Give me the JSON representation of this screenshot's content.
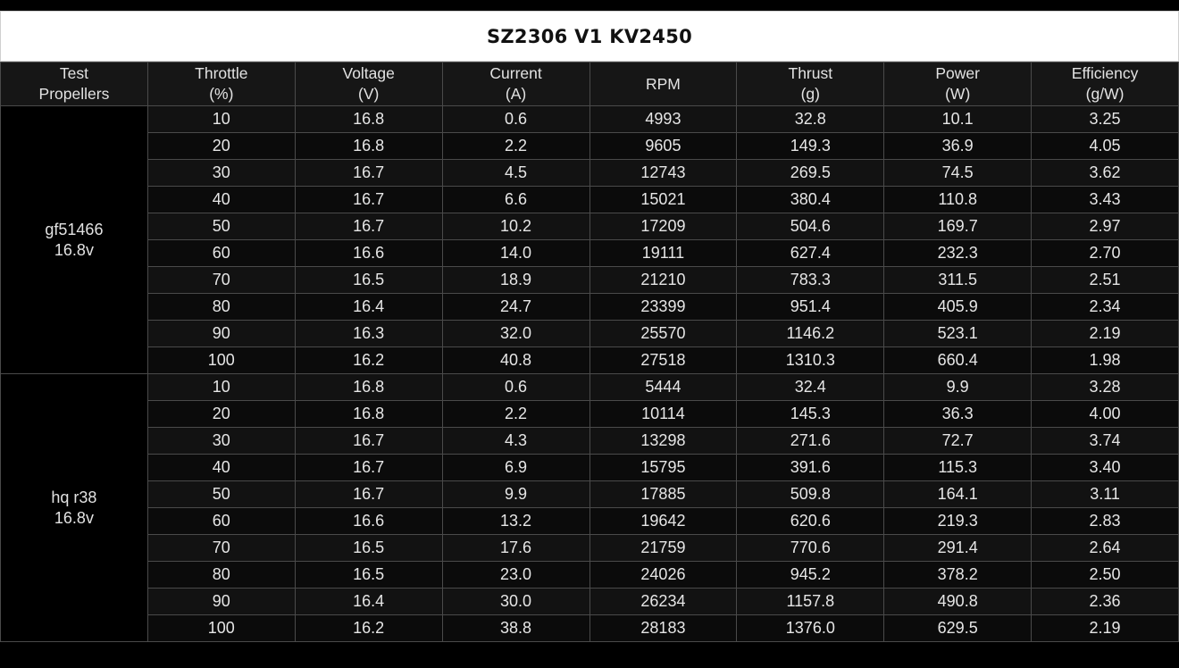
{
  "title": "SZ2306 V1 KV2450",
  "headers": [
    [
      "Test",
      "Propellers"
    ],
    [
      "Throttle",
      "(%)"
    ],
    [
      "Voltage",
      "(V)"
    ],
    [
      "Current",
      "(A)"
    ],
    [
      "RPM"
    ],
    [
      "Thrust",
      "(g)"
    ],
    [
      "Power",
      "(W)"
    ],
    [
      "Efficiency",
      "(g/W)"
    ]
  ],
  "groups": [
    {
      "propeller": [
        "gf51466",
        "16.8v"
      ],
      "rows": [
        [
          "10",
          "16.8",
          "0.6",
          "4993",
          "32.8",
          "10.1",
          "3.25"
        ],
        [
          "20",
          "16.8",
          "2.2",
          "9605",
          "149.3",
          "36.9",
          "4.05"
        ],
        [
          "30",
          "16.7",
          "4.5",
          "12743",
          "269.5",
          "74.5",
          "3.62"
        ],
        [
          "40",
          "16.7",
          "6.6",
          "15021",
          "380.4",
          "110.8",
          "3.43"
        ],
        [
          "50",
          "16.7",
          "10.2",
          "17209",
          "504.6",
          "169.7",
          "2.97"
        ],
        [
          "60",
          "16.6",
          "14.0",
          "19111",
          "627.4",
          "232.3",
          "2.70"
        ],
        [
          "70",
          "16.5",
          "18.9",
          "21210",
          "783.3",
          "311.5",
          "2.51"
        ],
        [
          "80",
          "16.4",
          "24.7",
          "23399",
          "951.4",
          "405.9",
          "2.34"
        ],
        [
          "90",
          "16.3",
          "32.0",
          "25570",
          "1146.2",
          "523.1",
          "2.19"
        ],
        [
          "100",
          "16.2",
          "40.8",
          "27518",
          "1310.3",
          "660.4",
          "1.98"
        ]
      ]
    },
    {
      "propeller": [
        "hq r38",
        "16.8v"
      ],
      "rows": [
        [
          "10",
          "16.8",
          "0.6",
          "5444",
          "32.4",
          "9.9",
          "3.28"
        ],
        [
          "20",
          "16.8",
          "2.2",
          "10114",
          "145.3",
          "36.3",
          "4.00"
        ],
        [
          "30",
          "16.7",
          "4.3",
          "13298",
          "271.6",
          "72.7",
          "3.74"
        ],
        [
          "40",
          "16.7",
          "6.9",
          "15795",
          "391.6",
          "115.3",
          "3.40"
        ],
        [
          "50",
          "16.7",
          "9.9",
          "17885",
          "509.8",
          "164.1",
          "3.11"
        ],
        [
          "60",
          "16.6",
          "13.2",
          "19642",
          "620.6",
          "219.3",
          "2.83"
        ],
        [
          "70",
          "16.5",
          "17.6",
          "21759",
          "770.6",
          "291.4",
          "2.64"
        ],
        [
          "80",
          "16.5",
          "23.0",
          "24026",
          "945.2",
          "378.2",
          "2.50"
        ],
        [
          "90",
          "16.4",
          "30.0",
          "26234",
          "1157.8",
          "490.8",
          "2.36"
        ],
        [
          "100",
          "16.2",
          "38.8",
          "28183",
          "1376.0",
          "629.5",
          "2.19"
        ]
      ]
    }
  ]
}
